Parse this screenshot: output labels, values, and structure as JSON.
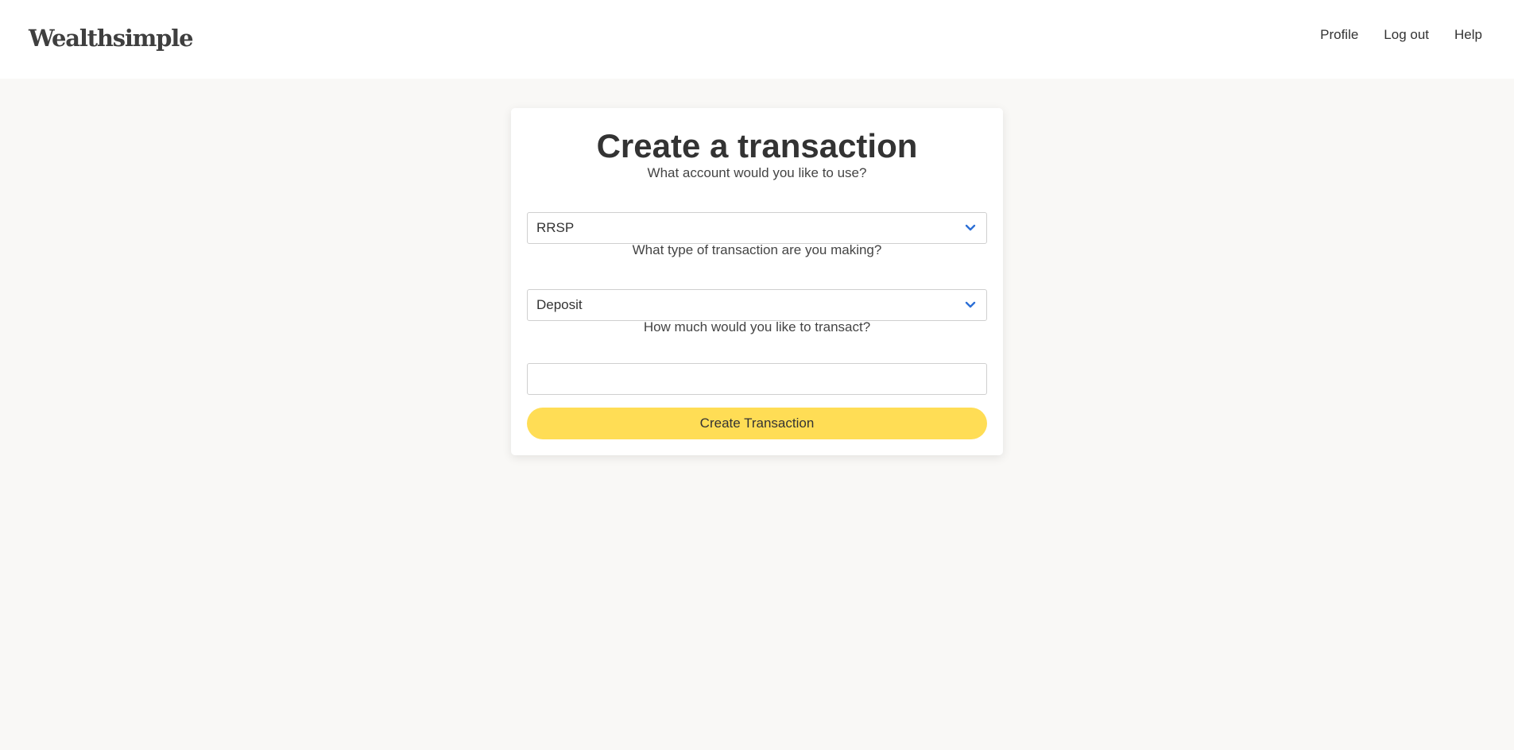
{
  "header": {
    "logo": "Wealthsimple",
    "nav": [
      "Profile",
      "Log out",
      "Help"
    ]
  },
  "form": {
    "title": "Create a transaction",
    "account_question": "What account would you like to use?",
    "account_value": "RRSP",
    "type_question": "What type of transaction are you making?",
    "type_value": "Deposit",
    "amount_question": "How much would you like to transact?",
    "amount_value": "",
    "submit_label": "Create Transaction"
  },
  "icons": {
    "dropdown": "chevron-down-icon"
  },
  "colors": {
    "page_background": "#f9f8f6",
    "header_background": "#ffffff",
    "card_background": "#ffffff",
    "button": "#ffdd55",
    "chevron": "#2c6fd6",
    "text": "#333333"
  }
}
